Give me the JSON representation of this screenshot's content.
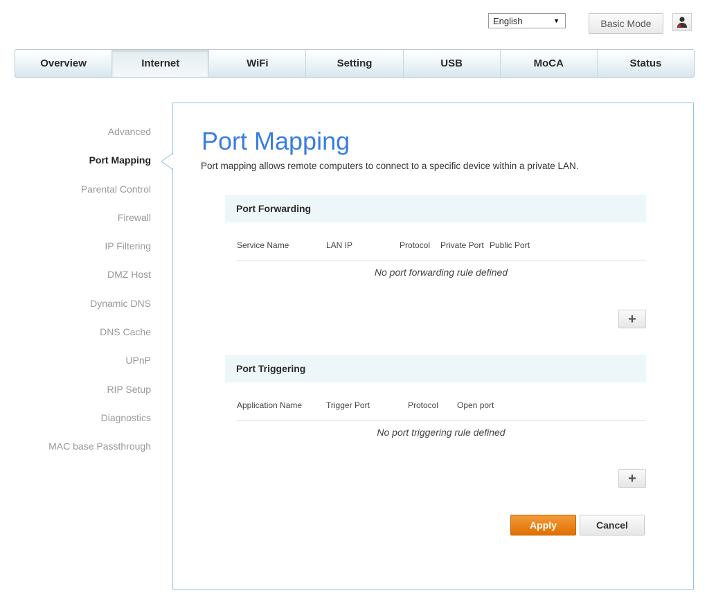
{
  "header": {
    "language_selected": "English",
    "basic_mode_label": "Basic Mode",
    "user_icon": "user-icon"
  },
  "nav": {
    "tabs": [
      "Overview",
      "Internet",
      "WiFi",
      "Setting",
      "USB",
      "MoCA",
      "Status"
    ],
    "active": "Internet"
  },
  "sidebar": {
    "items": [
      "Advanced",
      "Port Mapping",
      "Parental Control",
      "Firewall",
      "IP Filtering",
      "DMZ Host",
      "Dynamic DNS",
      "DNS Cache",
      "UPnP",
      "RIP Setup",
      "Diagnostics",
      "MAC base Passthrough"
    ],
    "active": "Port Mapping"
  },
  "main": {
    "title": "Port Mapping",
    "description": "Port mapping allows remote computers to connect to a specific device within a private LAN.",
    "port_forwarding": {
      "heading": "Port Forwarding",
      "columns": [
        "Service Name",
        "LAN IP",
        "Protocol",
        "Private Port",
        "Public Port"
      ],
      "empty_message": "No port forwarding rule defined",
      "add_label": "+"
    },
    "port_triggering": {
      "heading": "Port Triggering",
      "columns": [
        "Application Name",
        "Trigger Port",
        "Protocol",
        "Open port"
      ],
      "empty_message": "No port triggering rule defined",
      "add_label": "+"
    },
    "apply_label": "Apply",
    "cancel_label": "Cancel"
  },
  "colors": {
    "accent_title": "#3a7de0",
    "apply_button": "#e9820f",
    "panel_border": "#8ec5de",
    "section_bg": "#edf7fa"
  }
}
